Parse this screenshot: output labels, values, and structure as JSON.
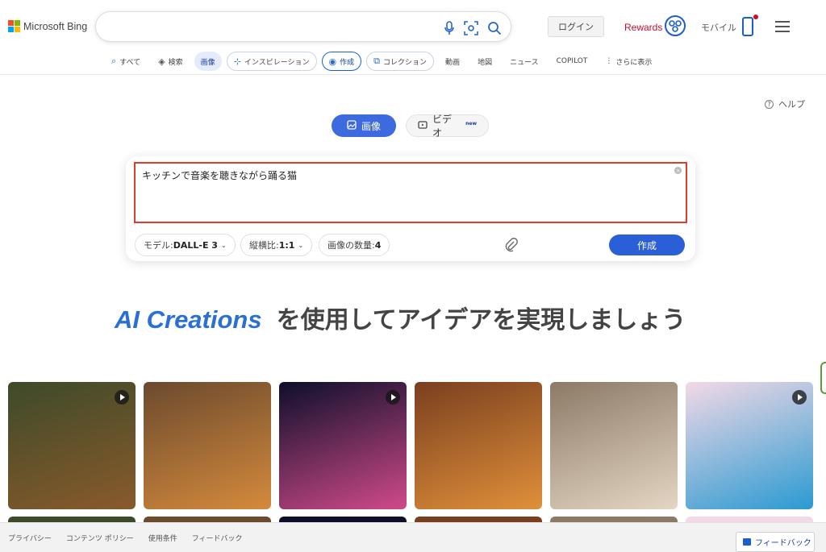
{
  "logo": {
    "text": "Microsoft Bing",
    "colors": [
      "#f25022",
      "#7fba00",
      "#00a4ef",
      "#ffb900"
    ]
  },
  "search": {
    "value": "",
    "icons": [
      "mic-icon",
      "visual-search-icon",
      "search-icon"
    ]
  },
  "header": {
    "login_label": "ログイン",
    "rewards_label": "Rewards",
    "mobile_label": "モバイル"
  },
  "nav": {
    "all": "すべて",
    "search": "検索",
    "images": "画像",
    "inspiration": "インスピレーション",
    "create": "作成",
    "collections": "コレクション",
    "videos": "動画",
    "maps": "地図",
    "news": "ニュース",
    "copilot": "COPILOT",
    "more": "さらに表示"
  },
  "help_label": "ヘルプ",
  "mode_tabs": {
    "image": "画像",
    "video": "ビデオ",
    "new_badge": "new"
  },
  "prompt": {
    "value": "キッチンで音楽を聴きながら踊る猫"
  },
  "options": {
    "model_label": "モデル: ",
    "model_value": "DALL-E 3",
    "aspect_label": "縦横比: ",
    "aspect_value": "1:1",
    "count_label": "画像の数量: ",
    "count_value": "4"
  },
  "create_button": "作成",
  "hero": {
    "brand": "AI Creations",
    "text": "を使用してアイデアを実現しましょう"
  },
  "gallery": [
    {
      "name": "fox-forest",
      "colors": [
        "#3d4a2a",
        "#8a5a2b"
      ],
      "video": true
    },
    {
      "name": "pumpkin-pie",
      "colors": [
        "#6b4a2e",
        "#d58a3c"
      ],
      "video": false
    },
    {
      "name": "city-fireworks",
      "colors": [
        "#0d0f2a",
        "#d04a8a"
      ],
      "video": true
    },
    {
      "name": "apple-basket",
      "colors": [
        "#7a3f1f",
        "#e0903a"
      ],
      "video": false
    },
    {
      "name": "woman-coffee",
      "colors": [
        "#8c7a66",
        "#e4d6c4"
      ],
      "video": false
    },
    {
      "name": "birthday-cake",
      "colors": [
        "#f3d9e6",
        "#2a9ad1"
      ],
      "video": true
    }
  ],
  "footer": {
    "links": [
      "プライバシー",
      "コンテンツ ポリシー",
      "使用条件",
      "フィードバック"
    ],
    "feedback_button": "フィードバック"
  }
}
